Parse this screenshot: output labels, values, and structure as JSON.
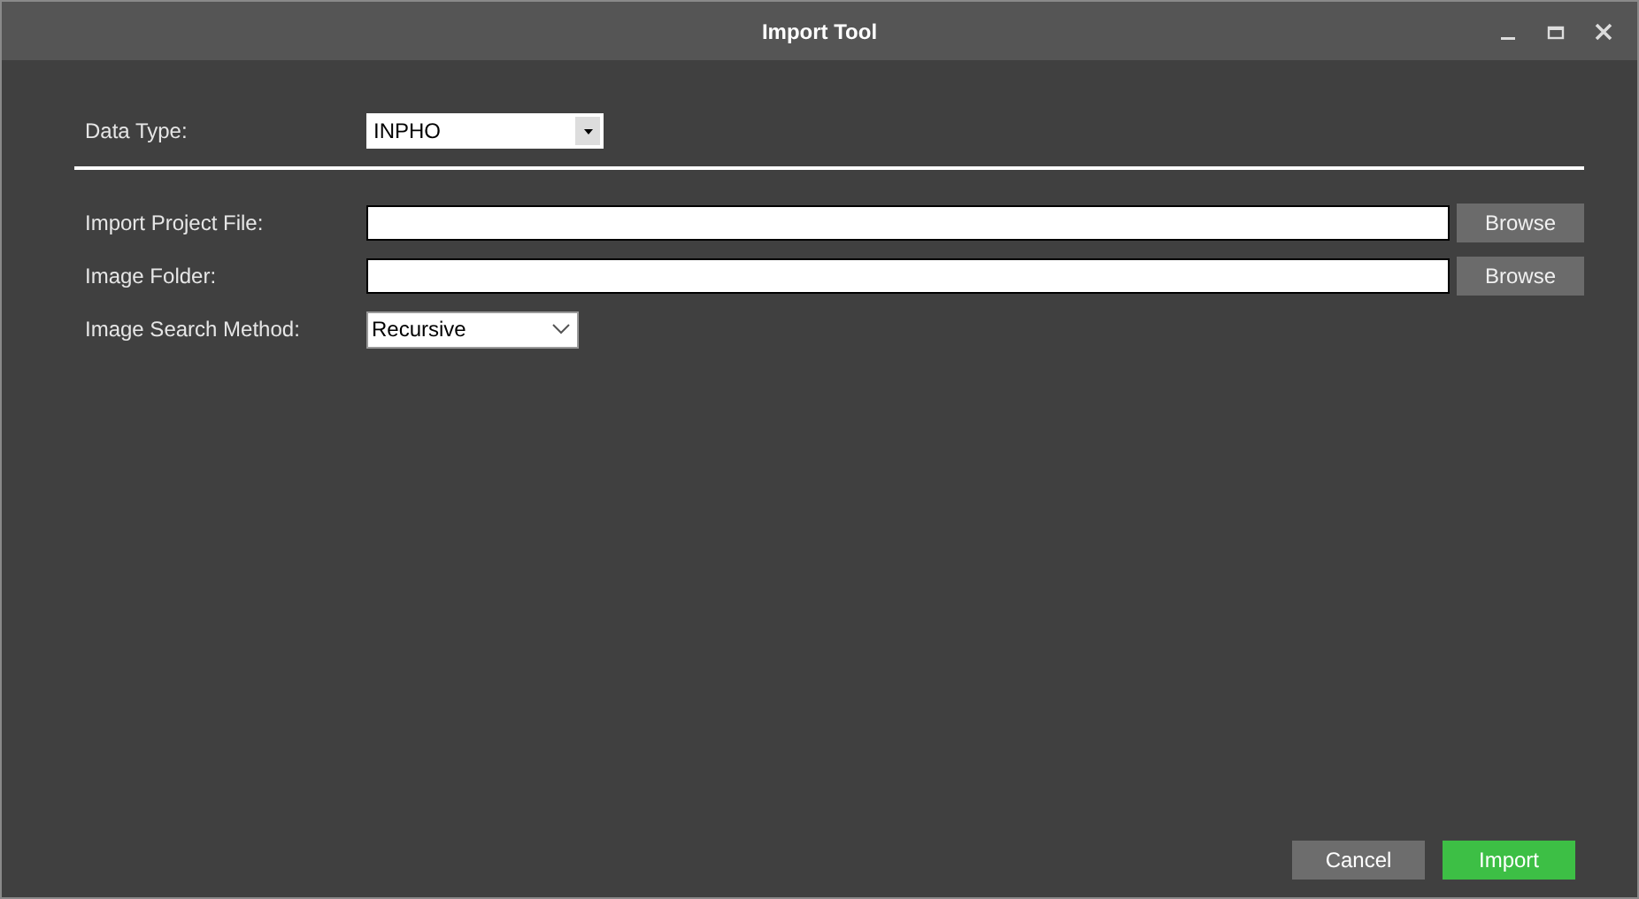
{
  "window": {
    "title": "Import Tool"
  },
  "data_type": {
    "label": "Data Type:",
    "value": "INPHO"
  },
  "fields": [
    {
      "kind": "path",
      "label": "Import Project File:",
      "button": "Browse"
    },
    {
      "kind": "path",
      "label": "Image Folder:",
      "button": "Browse"
    },
    {
      "kind": "combo",
      "label": "Image Search Method:",
      "value": "Recursive"
    }
  ],
  "buttons": [
    {
      "kind": "secondary",
      "label": "Cancel"
    },
    {
      "kind": "primary",
      "label": "Import"
    }
  ]
}
